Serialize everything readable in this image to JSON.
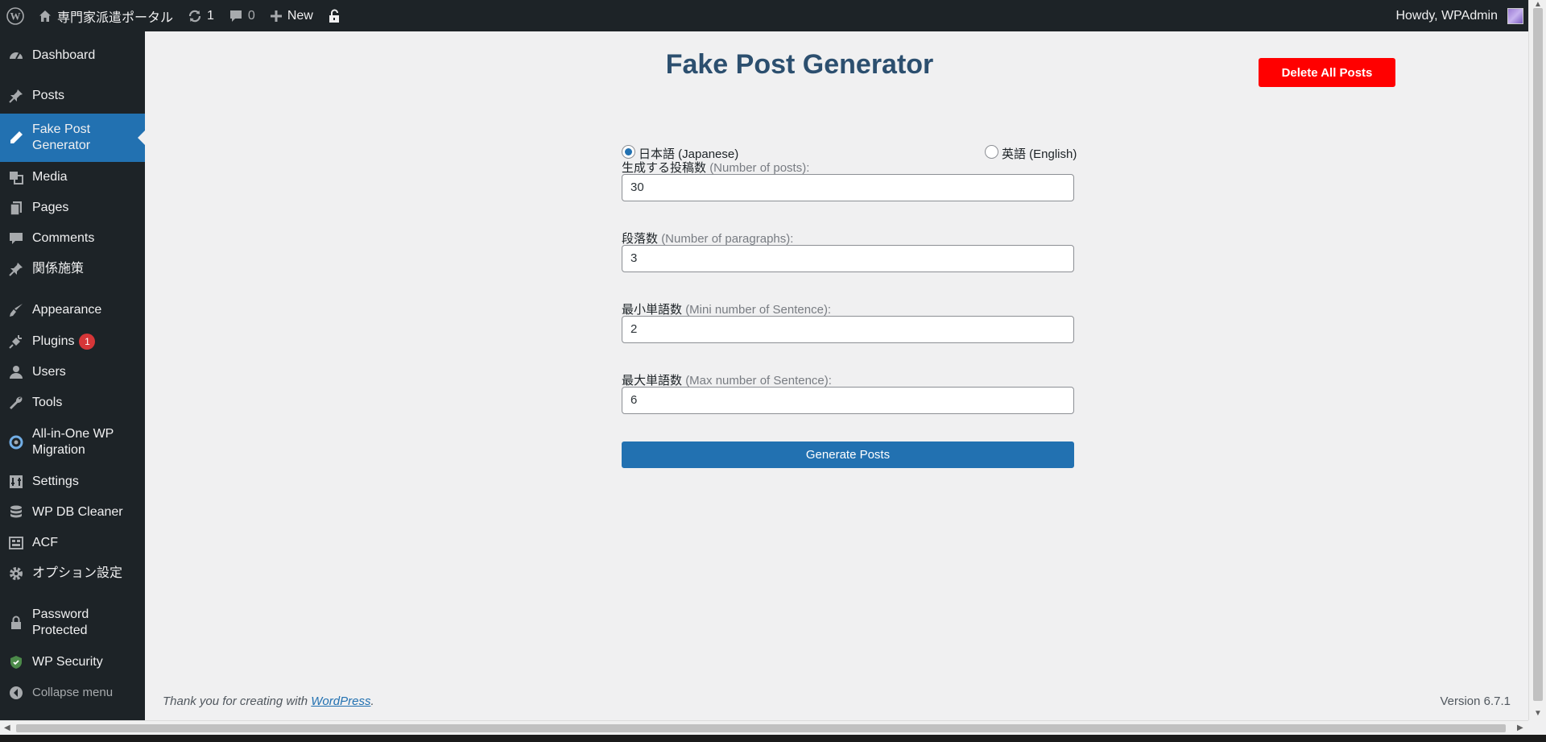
{
  "adminbar": {
    "site_name": "専門家派遣ポータル",
    "updates_count": "1",
    "comments_count": "0",
    "new_label": "New",
    "howdy": "Howdy, WPAdmin"
  },
  "sidebar": {
    "items": [
      {
        "label": "Dashboard",
        "icon": "dashboard-icon"
      },
      {
        "label": "Posts",
        "icon": "pin-icon"
      },
      {
        "label": "Fake Post Generator",
        "icon": "pencil-icon",
        "current": true
      },
      {
        "label": "Media",
        "icon": "media-icon"
      },
      {
        "label": "Pages",
        "icon": "pages-icon"
      },
      {
        "label": "Comments",
        "icon": "comment-icon"
      },
      {
        "label": "関係施策",
        "icon": "pin-icon"
      },
      {
        "label": "Appearance",
        "icon": "brush-icon"
      },
      {
        "label": "Plugins",
        "icon": "plug-icon",
        "badge": "1"
      },
      {
        "label": "Users",
        "icon": "user-icon"
      },
      {
        "label": "Tools",
        "icon": "wrench-icon"
      },
      {
        "label": "All-in-One WP Migration",
        "icon": "migration-icon"
      },
      {
        "label": "Settings",
        "icon": "settings-icon"
      },
      {
        "label": "WP DB Cleaner",
        "icon": "database-icon"
      },
      {
        "label": "ACF",
        "icon": "acf-icon"
      },
      {
        "label": "オプション設定",
        "icon": "gear-icon"
      },
      {
        "label": "Password Protected",
        "icon": "lock-icon"
      },
      {
        "label": "WP Security",
        "icon": "shield-icon"
      }
    ],
    "collapse_label": "Collapse menu"
  },
  "main": {
    "title": "Fake Post Generator",
    "delete_label": "Delete All Posts",
    "radio_japanese": "日本語 (Japanese)",
    "radio_english": "英語 (English)",
    "selected_language": "Japanese",
    "fields": [
      {
        "label_jp": "生成する投稿数",
        "label_en": "(Number of posts):",
        "value": "30"
      },
      {
        "label_jp": "段落数",
        "label_en": "(Number of paragraphs):",
        "value": "3"
      },
      {
        "label_jp": "最小単語数",
        "label_en": "(Mini number of Sentence):",
        "value": "2"
      },
      {
        "label_jp": "最大単語数",
        "label_en": "(Max number of Sentence):",
        "value": "6"
      }
    ],
    "generate_label": "Generate Posts"
  },
  "footer": {
    "thanks_prefix": "Thank you for creating with ",
    "thanks_link": "WordPress",
    "thanks_suffix": ".",
    "version": "Version 6.7.1"
  },
  "colors": {
    "adminbar_bg": "#1d2327",
    "accent": "#2271b1",
    "danger": "#ff0000",
    "title": "#2c4f6f"
  }
}
